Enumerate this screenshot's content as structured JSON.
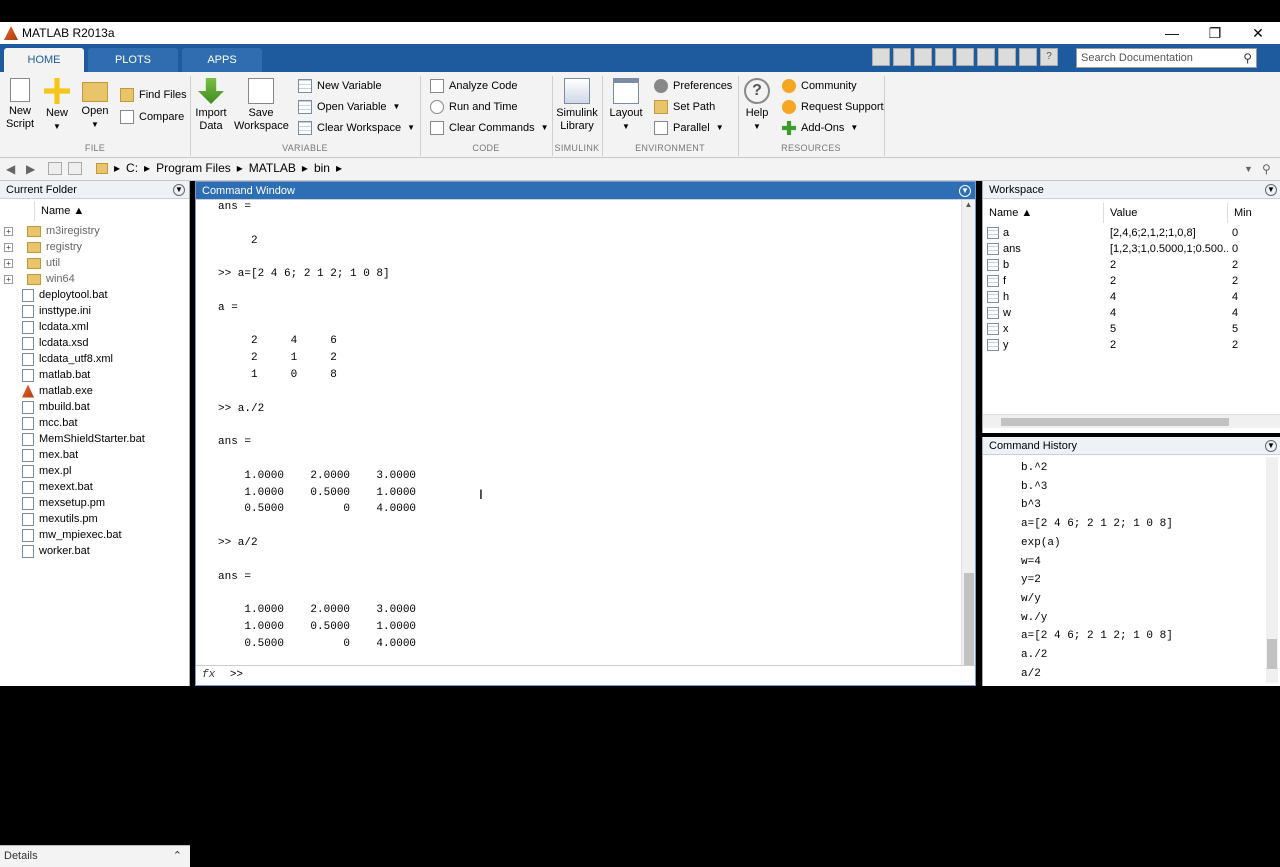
{
  "window": {
    "title": "MATLAB R2013a",
    "controls": [
      "—",
      "❐",
      "✕"
    ]
  },
  "ribbon_tabs": [
    "HOME",
    "PLOTS",
    "APPS"
  ],
  "search": {
    "placeholder": "Search Documentation"
  },
  "ribbon": {
    "file": {
      "label": "FILE",
      "new_script": "New\nScript",
      "new": "New",
      "open": "Open",
      "find_files": "Find Files",
      "compare": "Compare"
    },
    "variable": {
      "label": "VARIABLE",
      "import_data": "Import\nData",
      "save_workspace": "Save\nWorkspace",
      "new_variable": "New Variable",
      "open_variable": "Open Variable",
      "clear_workspace": "Clear Workspace"
    },
    "code": {
      "label": "CODE",
      "analyze_code": "Analyze Code",
      "run_and_time": "Run and Time",
      "clear_commands": "Clear Commands"
    },
    "simulink": {
      "label": "SIMULINK",
      "simulink_library": "Simulink\nLibrary"
    },
    "environment": {
      "label": "ENVIRONMENT",
      "layout": "Layout",
      "preferences": "Preferences",
      "set_path": "Set Path",
      "parallel": "Parallel"
    },
    "resources": {
      "label": "RESOURCES",
      "help": "Help",
      "community": "Community",
      "request_support": "Request Support",
      "add_ons": "Add-Ons"
    }
  },
  "address": {
    "path": [
      "C:",
      "Program Files",
      "MATLAB",
      "bin"
    ]
  },
  "current_folder": {
    "title": "Current Folder",
    "column": "Name ▲",
    "folders": [
      "m3iregistry",
      "registry",
      "util",
      "win64"
    ],
    "files": [
      "deploytool.bat",
      "insttype.ini",
      "lcdata.xml",
      "lcdata.xsd",
      "lcdata_utf8.xml",
      "matlab.bat",
      "matlab.exe",
      "mbuild.bat",
      "mcc.bat",
      "MemShieldStarter.bat",
      "mex.bat",
      "mex.pl",
      "mexext.bat",
      "mexsetup.pm",
      "mexutils.pm",
      "mw_mpiexec.bat",
      "worker.bat"
    ],
    "details": "Details"
  },
  "command_window": {
    "title": "Command Window",
    "lines": [
      "ans =",
      "",
      "     2",
      "",
      ">> a=[2 4 6; 2 1 2; 1 0 8]",
      "",
      "a =",
      "",
      "     2     4     6",
      "     2     1     2",
      "     1     0     8",
      "",
      ">> a./2",
      "",
      "ans =",
      "",
      "    1.0000    2.0000    3.0000",
      "    1.0000    0.5000    1.0000",
      "    0.5000         0    4.0000",
      "",
      ">> a/2",
      "",
      "ans =",
      "",
      "    1.0000    2.0000    3.0000",
      "    1.0000    0.5000    1.0000",
      "    0.5000         0    4.0000"
    ],
    "prompt_fx": "fx",
    "prompt": ">>"
  },
  "workspace": {
    "title": "Workspace",
    "columns": [
      "Name ▲",
      "Value",
      "Min"
    ],
    "rows": [
      {
        "name": "a",
        "value": "[2,4,6;2,1,2;1,0,8]",
        "min": "0"
      },
      {
        "name": "ans",
        "value": "[1,2,3;1,0.5000,1;0.500...",
        "min": "0"
      },
      {
        "name": "b",
        "value": "2",
        "min": "2"
      },
      {
        "name": "f",
        "value": "2",
        "min": "2"
      },
      {
        "name": "h",
        "value": "4",
        "min": "4"
      },
      {
        "name": "w",
        "value": "4",
        "min": "4"
      },
      {
        "name": "x",
        "value": "5",
        "min": "5"
      },
      {
        "name": "y",
        "value": "2",
        "min": "2"
      }
    ]
  },
  "command_history": {
    "title": "Command History",
    "items": [
      "b.^2",
      "b.^3",
      "b^3",
      "a=[2 4 6; 2 1 2; 1 0 8]",
      "exp(a)",
      "w=4",
      "y=2",
      "w/y",
      "w./y",
      "a=[2 4 6; 2 1 2; 1 0 8]",
      "a./2",
      "a/2"
    ]
  },
  "colors": {
    "ribbon_blue": "#1e5b9e",
    "panel_header_active": "#2e6eb5"
  },
  "icons": [
    "matlab-logo-icon",
    "new-script-icon",
    "new-icon",
    "open-folder-icon",
    "find-files-icon",
    "compare-icon",
    "import-data-icon",
    "save-workspace-icon",
    "new-variable-icon",
    "open-variable-icon",
    "clear-workspace-icon",
    "analyze-code-icon",
    "run-and-time-icon",
    "clear-commands-icon",
    "simulink-library-icon",
    "layout-icon",
    "preferences-icon",
    "set-path-icon",
    "parallel-icon",
    "help-icon",
    "community-icon",
    "request-support-icon",
    "add-ons-icon",
    "back-icon",
    "forward-icon",
    "up-folder-icon",
    "browse-icon",
    "search-icon",
    "folder-icon",
    "file-icon",
    "variable-icon",
    "action-menu-icon"
  ]
}
